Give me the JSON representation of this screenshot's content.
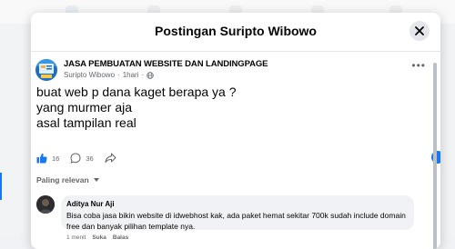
{
  "modal": {
    "title": "Postingan Suripto Wibowo"
  },
  "post": {
    "page_name": "JASA PEMBUATAN WEBSITE DAN LANDINGPAGE",
    "author": "Suripto Wibowo",
    "separator": "·",
    "time": "1hari",
    "privacy_sep": "·",
    "lines": [
      "buat web p dana kaget berapa ya ?",
      "yang murmer aja",
      "asal tampilan real"
    ],
    "like_count": "16",
    "comment_count": "36"
  },
  "comments_sort": {
    "label": "Paling relevan"
  },
  "comment": {
    "author": "Aditya Nur Aji",
    "text": "Bisa coba jasa bikin website di idwebhost kak, ada paket hemat sekitar 700k sudah include domain free dan banyak pilihan template nya.",
    "time": "1 menit",
    "like_label": "Suka",
    "reply_label": "Balas"
  },
  "colors": {
    "accent": "#1877f2",
    "secondary_text": "#65676b",
    "bubble": "#f0f2f5"
  },
  "icons": {
    "close": "close-icon",
    "globe": "globe-icon",
    "like": "thumbs-up-icon",
    "comment": "comment-icon",
    "share": "share-icon",
    "sort": "chevron-down-icon",
    "more": "more-icon"
  }
}
